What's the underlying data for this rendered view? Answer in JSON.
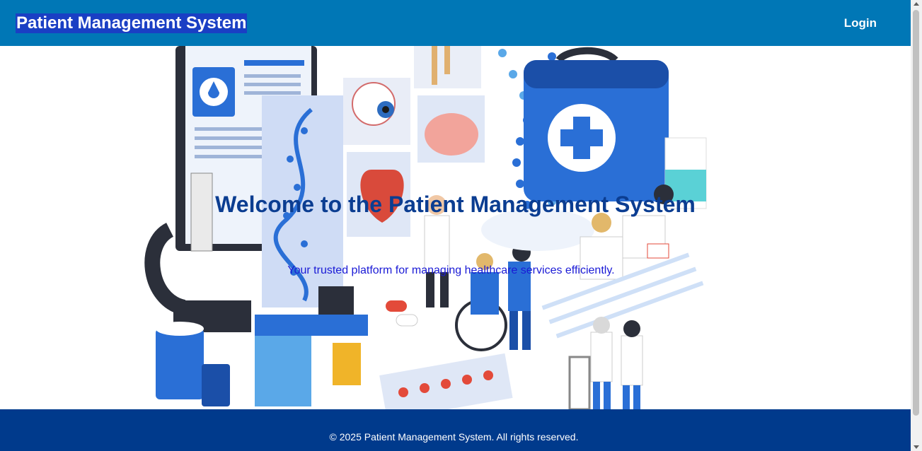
{
  "header": {
    "brand": "Patient Management System",
    "login_label": "Login"
  },
  "hero": {
    "title": "Welcome to the Patient Management System",
    "subtitle": "Your trusted platform for managing healthcare services efficiently."
  },
  "footer": {
    "copyright": "© 2025 Patient Management System. All rights reserved."
  },
  "colors": {
    "header_bg": "#0077b6",
    "footer_bg": "#003a8c",
    "title": "#0b3d91",
    "subtitle": "#1a1ad6"
  }
}
